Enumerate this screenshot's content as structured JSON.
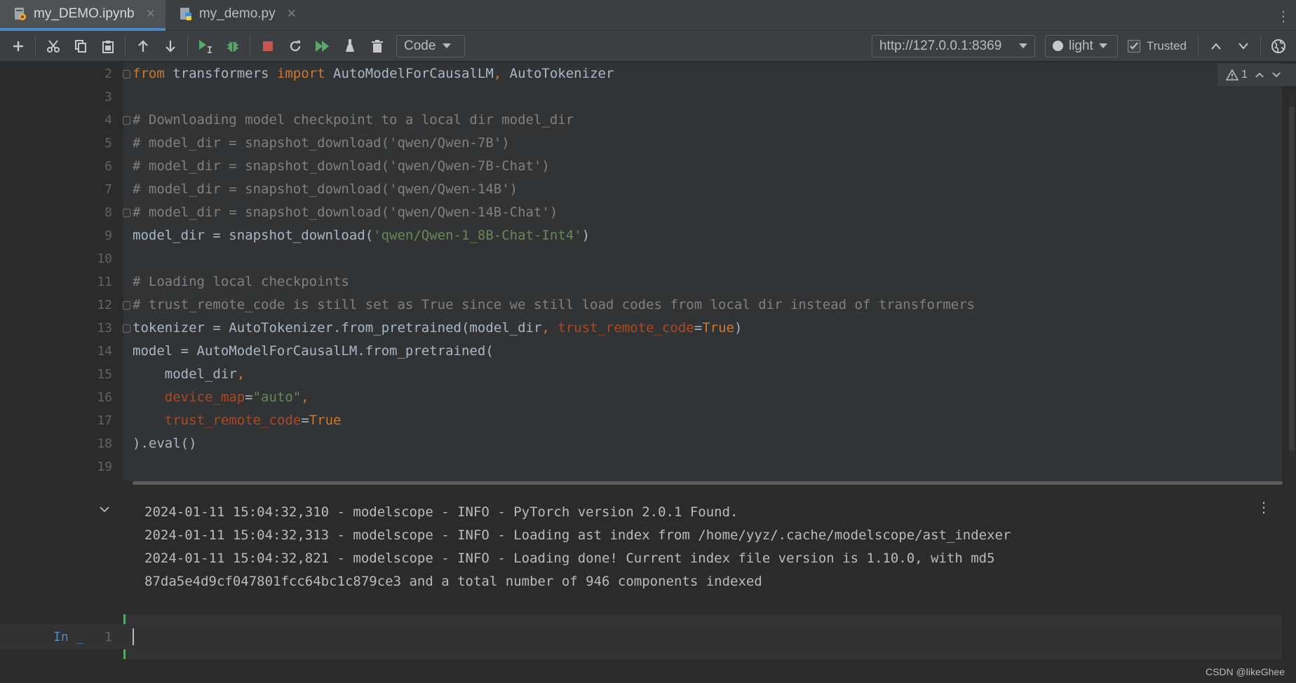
{
  "tabs": [
    {
      "name": "my_DEMO.ipynb",
      "active": true
    },
    {
      "name": "my_demo.py",
      "active": false
    }
  ],
  "toolbar": {
    "cell_type": "Code",
    "kernel_url": "http://127.0.0.1:8369",
    "theme": "light",
    "trusted_label": "Trusted",
    "trusted_checked": true
  },
  "inspections": {
    "warning_count": "1"
  },
  "code": {
    "line_numbers": [
      "2",
      "3",
      "4",
      "5",
      "6",
      "7",
      "8",
      "9",
      "10",
      "11",
      "12",
      "13",
      "14",
      "15",
      "16",
      "17",
      "18",
      "19"
    ],
    "l2": {
      "kw_from": "from",
      "mod": " transformers ",
      "kw_import": "import",
      "names": " AutoModelForCausalLM",
      "comma": ",",
      "names2": " AutoTokenizer"
    },
    "l4": "# Downloading model checkpoint to a local dir model_dir",
    "l5": "# model_dir = snapshot_download('qwen/Qwen-7B')",
    "l6": "# model_dir = snapshot_download('qwen/Qwen-7B-Chat')",
    "l7": "# model_dir = snapshot_download('qwen/Qwen-14B')",
    "l8": "# model_dir = snapshot_download('qwen/Qwen-14B-Chat')",
    "l9": {
      "pre": "model_dir = snapshot_download(",
      "str": "'qwen/Qwen-1_8B-Chat-Int4'",
      "post": ")"
    },
    "l11": "# Loading local checkpoints",
    "l12": "# trust_remote_code is still set as True since we still load codes from local dir instead of transformers",
    "l13": {
      "pre": "tokenizer = AutoTokenizer.from_pretrained(model_dir",
      "comma": ",",
      "param": " trust_remote_code",
      "eq": "=",
      "val": "True",
      "post": ")"
    },
    "l14": "model = AutoModelForCausalLM.from_pretrained(",
    "l15": {
      "indent": "    ",
      "text": "model_dir",
      "comma": ","
    },
    "l16": {
      "indent": "    ",
      "param": "device_map",
      "eq": "=",
      "str": "\"auto\"",
      "comma": ","
    },
    "l17": {
      "indent": "    ",
      "param": "trust_remote_code",
      "eq": "=",
      "val": "True"
    },
    "l18": ").eval()"
  },
  "output": [
    "2024-01-11 15:04:32,310 - modelscope - INFO - PyTorch version 2.0.1 Found.",
    "2024-01-11 15:04:32,313 - modelscope - INFO - Loading ast index from /home/yyz/.cache/modelscope/ast_indexer",
    "2024-01-11 15:04:32,821 - modelscope - INFO - Loading done! Current index file version is 1.10.0, with md5",
    "87da5e4d9cf047801fcc64bc1c879ce3 and a total number of 946 components indexed"
  ],
  "next_cell": {
    "prompt": "In _",
    "line_number": "1"
  },
  "watermark": "CSDN @likeGhee",
  "colors": {
    "background": "#2b2b2b",
    "toolbar": "#3c3f41",
    "keyword": "#cc7832",
    "comment": "#808080",
    "string": "#6a8759",
    "parameter": "#aa4926",
    "run_green": "#59a869",
    "stop_red": "#c75450",
    "accent_blue": "#4a88c7"
  }
}
